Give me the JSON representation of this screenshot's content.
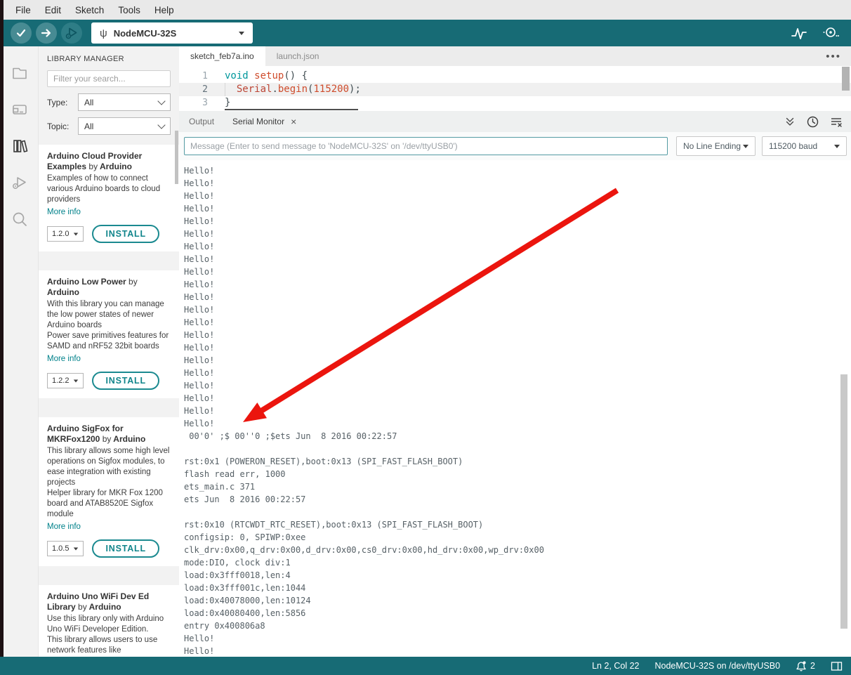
{
  "menu_bar": {
    "items": [
      "File",
      "Edit",
      "Sketch",
      "Tools",
      "Help"
    ]
  },
  "toolbar": {
    "board_name": "NodeMCU-32S"
  },
  "icons": {
    "verify": "check",
    "upload": "arrow-right",
    "debug": "bug-play",
    "board_port": "usb-trident",
    "serial_plotter": "waveform",
    "serial_monitor": "scope-dots",
    "activity": [
      "folder",
      "boards-manager",
      "library-books",
      "debugger",
      "search"
    ],
    "panel": [
      "collapse-double-chevron",
      "timestamp-clock",
      "clear-output"
    ],
    "status": [
      "notification-bell",
      "panel-layout"
    ]
  },
  "library_manager": {
    "title": "LIBRARY MANAGER",
    "filter_placeholder": "Filter your search...",
    "type_label": "Type:",
    "type_value": "All",
    "topic_label": "Topic:",
    "topic_value": "All",
    "libraries": [
      {
        "name": "Arduino Cloud Provider Examples",
        "by_label": "by",
        "author": "Arduino",
        "description": "Examples of how to connect various Arduino boards to cloud providers",
        "more_info_label": "More info",
        "version": "1.2.0",
        "install_label": "INSTALL"
      },
      {
        "name": "Arduino Low Power",
        "by_label": "by",
        "author": "Arduino",
        "description": "With this library you can manage the low power states of newer Arduino boards\nPower save primitives features for SAMD and nRF52 32bit boards",
        "more_info_label": "More info",
        "version": "1.2.2",
        "install_label": "INSTALL"
      },
      {
        "name": "Arduino SigFox for MKRFox1200",
        "by_label": "by",
        "author": "Arduino",
        "description": "This library allows some high level operations on Sigfox modules, to ease integration with existing projects\nHelper library for MKR Fox 1200 board and ATAB8520E Sigfox module",
        "more_info_label": "More info",
        "version": "1.0.5",
        "install_label": "INSTALL"
      },
      {
        "name": "Arduino Uno WiFi Dev Ed Library",
        "by_label": "by",
        "author": "Arduino",
        "description": "Use this library only with Arduino Uno WiFi Developer Edition.\nThis library allows users to use network features like"
      }
    ]
  },
  "editor": {
    "tabs": [
      {
        "label": "sketch_feb7a.ino"
      },
      {
        "label": "launch.json"
      }
    ],
    "line_numbers": [
      "1",
      "2",
      "3"
    ],
    "code": {
      "l1_keyword": "void",
      "l1_sp": " ",
      "l1_function": "setup",
      "l1_rest": "() {",
      "l2_indent": "  ",
      "l2_object": "Serial",
      "l2_dot": ".",
      "l2_method": "begin",
      "l2_open": "(",
      "l2_number": "115200",
      "l2_close": ");",
      "l3_brace": "}"
    }
  },
  "panel": {
    "output_tab": "Output",
    "serial_tab": "Serial Monitor",
    "message_placeholder": "Message (Enter to send message to 'NodeMCU-32S' on '/dev/ttyUSB0')",
    "line_ending": "No Line Ending",
    "baud_rate": "115200 baud",
    "output_lines": [
      "Hello!",
      "Hello!",
      "Hello!",
      "Hello!",
      "Hello!",
      "Hello!",
      "Hello!",
      "Hello!",
      "Hello!",
      "Hello!",
      "Hello!",
      "Hello!",
      "Hello!",
      "Hello!",
      "Hello!",
      "Hello!",
      "Hello!",
      "Hello!",
      "Hello!",
      "Hello!",
      "Hello!",
      " 00'0' ;$ 00''0 ;$ets Jun  8 2016 00:22:57",
      "",
      "rst:0x1 (POWERON_RESET),boot:0x13 (SPI_FAST_FLASH_BOOT)",
      "flash read err, 1000",
      "ets_main.c 371",
      "ets Jun  8 2016 00:22:57",
      "",
      "rst:0x10 (RTCWDT_RTC_RESET),boot:0x13 (SPI_FAST_FLASH_BOOT)",
      "configsip: 0, SPIWP:0xee",
      "clk_drv:0x00,q_drv:0x00,d_drv:0x00,cs0_drv:0x00,hd_drv:0x00,wp_drv:0x00",
      "mode:DIO, clock div:1",
      "load:0x3fff0018,len:4",
      "load:0x3fff001c,len:1044",
      "load:0x40078000,len:10124",
      "load:0x40080400,len:5856",
      "entry 0x400806a8",
      "Hello!",
      "Hello!"
    ]
  },
  "status_bar": {
    "cursor_position": "Ln 2, Col 22",
    "board_port": "NodeMCU-32S on /dev/ttyUSB0",
    "notification_count": "2"
  },
  "colors": {
    "toolbar_teal": "#176b75",
    "accent_teal": "#00818a",
    "arrow_red": "#eb150e"
  }
}
